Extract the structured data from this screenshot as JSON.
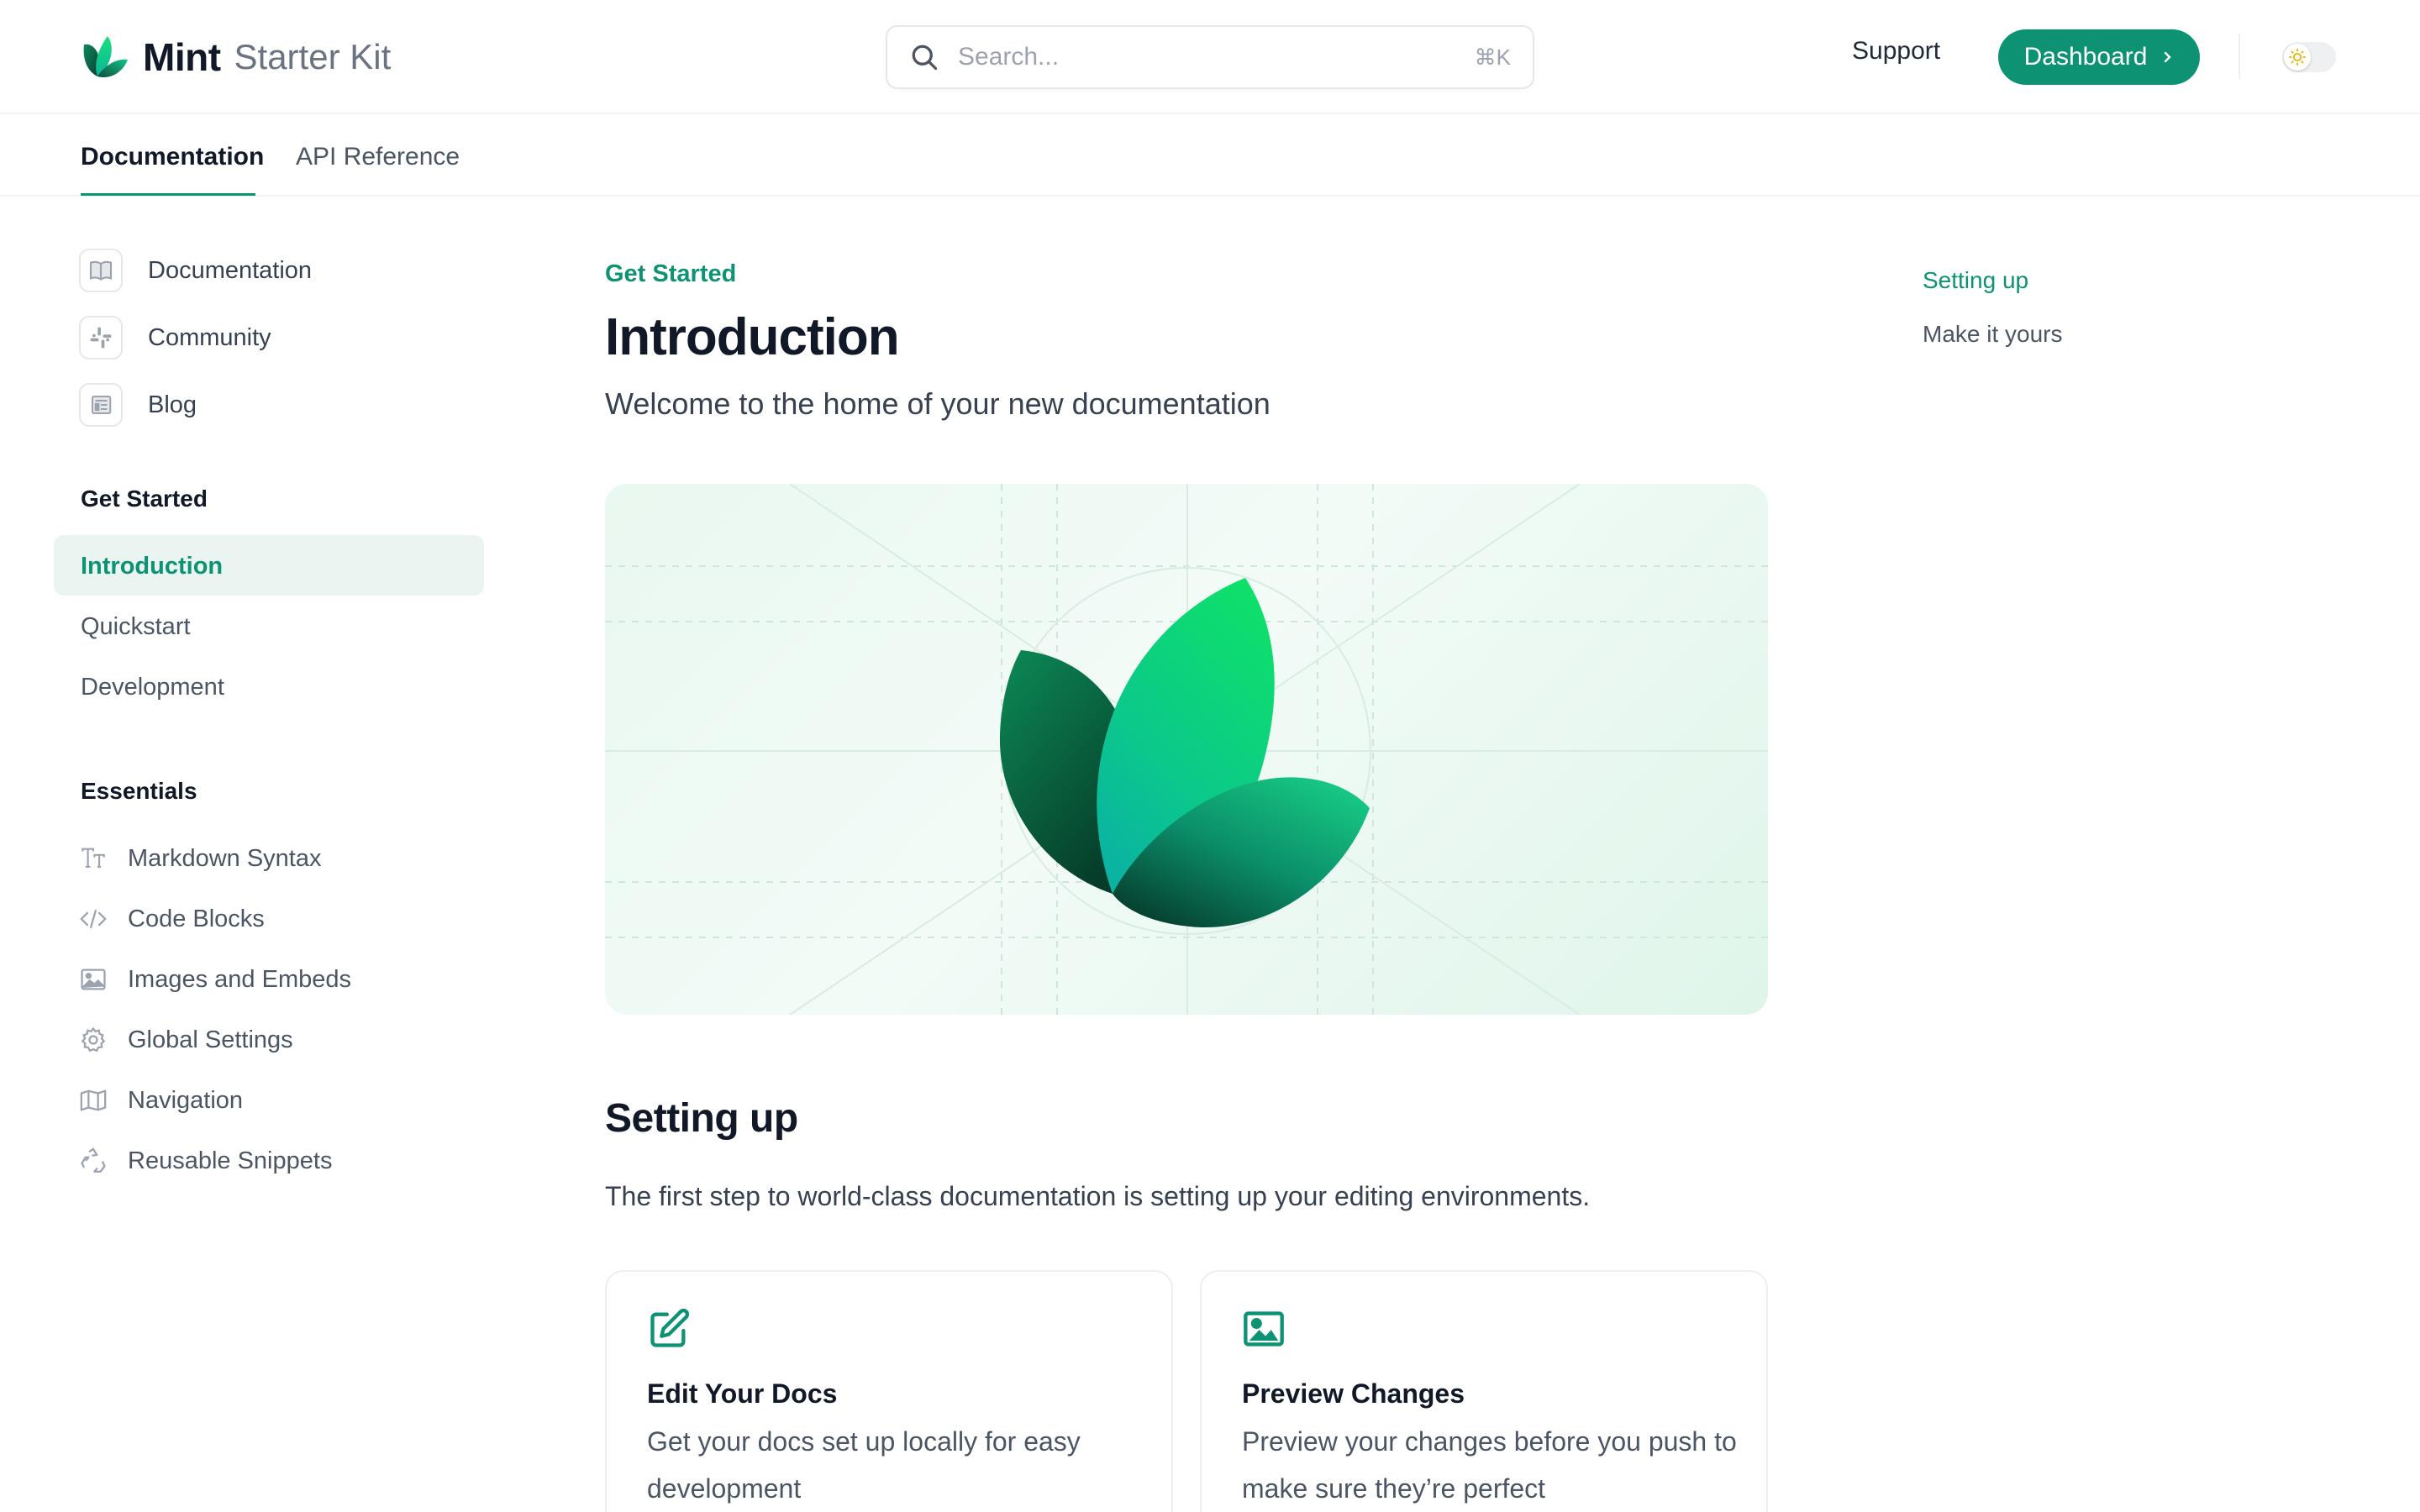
{
  "header": {
    "brand": "Mint",
    "product": "Starter Kit",
    "search_placeholder": "Search...",
    "search_shortcut": "⌘K",
    "support_label": "Support",
    "dashboard_label": "Dashboard",
    "theme_toggle_icon": "sun-icon"
  },
  "tabs": [
    {
      "label": "Documentation",
      "active": true
    },
    {
      "label": "API Reference",
      "active": false
    }
  ],
  "sidebar": {
    "anchors": [
      {
        "label": "Documentation",
        "icon": "book-icon"
      },
      {
        "label": "Community",
        "icon": "slack-icon"
      },
      {
        "label": "Blog",
        "icon": "newspaper-icon"
      }
    ],
    "groups": [
      {
        "title": "Get Started",
        "items": [
          {
            "label": "Introduction",
            "active": true
          },
          {
            "label": "Quickstart"
          },
          {
            "label": "Development"
          }
        ]
      },
      {
        "title": "Essentials",
        "items": [
          {
            "label": "Markdown Syntax",
            "icon": "text-size-icon"
          },
          {
            "label": "Code Blocks",
            "icon": "code-icon"
          },
          {
            "label": "Images and Embeds",
            "icon": "image-icon"
          },
          {
            "label": "Global Settings",
            "icon": "gear-icon"
          },
          {
            "label": "Navigation",
            "icon": "map-icon"
          },
          {
            "label": "Reusable Snippets",
            "icon": "recycle-icon"
          }
        ]
      }
    ]
  },
  "page": {
    "eyebrow": "Get Started",
    "title": "Introduction",
    "description": "Welcome to the home of your new documentation",
    "section_title": "Setting up",
    "section_text": "The first step to world-class documentation is setting up your editing environments.",
    "cards": [
      {
        "icon": "pen-to-square-icon",
        "title": "Edit Your Docs",
        "text": "Get your docs set up locally for easy development"
      },
      {
        "icon": "image-icon",
        "title": "Preview Changes",
        "text": "Preview your changes before you push to make sure they’re perfect"
      }
    ]
  },
  "toc": [
    {
      "label": "Setting up",
      "active": true
    },
    {
      "label": "Make it yours",
      "active": false
    }
  ],
  "colors": {
    "primary": "#0d9373",
    "primary_light": "#eaf5f1",
    "text_dark": "#111827"
  }
}
